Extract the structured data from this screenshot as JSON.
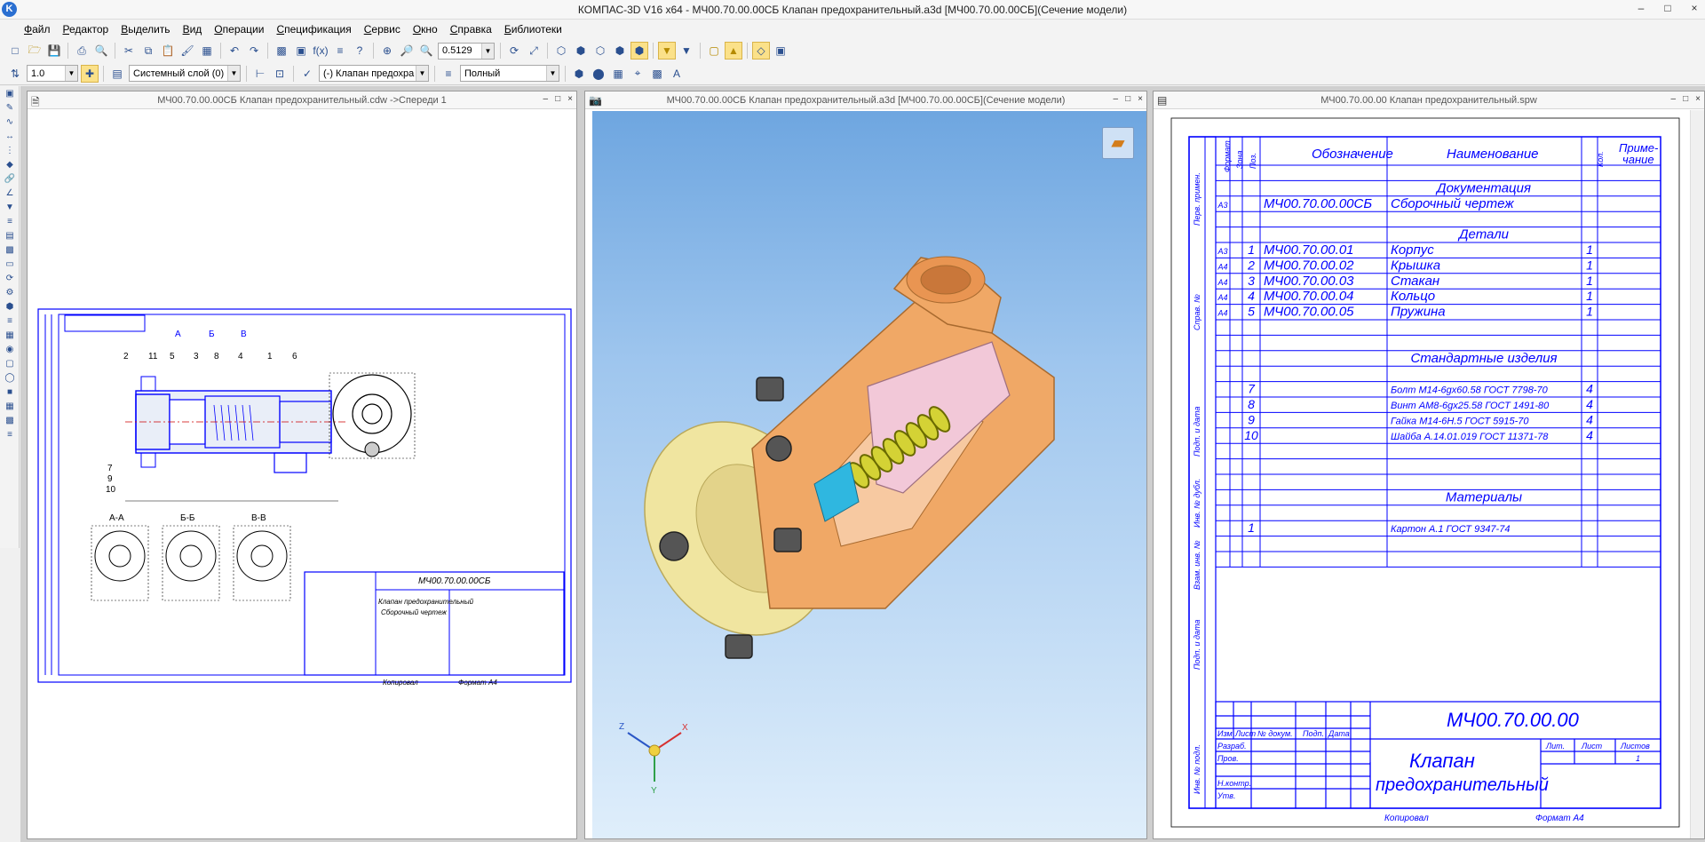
{
  "app": {
    "title": "КОМПАС-3D V16  x64 - МЧ00.70.00.00СБ Клапан предохранительный.a3d [МЧ00.70.00.00СБ](Сечение модели)",
    "window_buttons": [
      "–",
      "□",
      "×"
    ]
  },
  "menu": [
    "Файл",
    "Редактор",
    "Выделить",
    "Вид",
    "Операции",
    "Спецификация",
    "Сервис",
    "Окно",
    "Справка",
    "Библиотеки"
  ],
  "toolbar1": {
    "zoom_value": "0.5129"
  },
  "toolbar2": {
    "step_value": "1.0",
    "layer_value": "Системный слой (0)",
    "object_value": "(-) Клапан предохра",
    "view_mode_value": "Полный"
  },
  "windows": {
    "drawing": {
      "title": "МЧ00.70.00.00СБ Клапан предохранительный.cdw ->Спереди 1"
    },
    "model": {
      "title": "МЧ00.70.00.00СБ Клапан предохранительный.a3d [МЧ00.70.00.00СБ](Сечение модели)"
    },
    "spec": {
      "title": "МЧ00.70.00.00 Клапан  предохранительный.spw"
    },
    "buttons": [
      "–",
      "□",
      "×"
    ]
  },
  "axes": {
    "x": "X",
    "y": "Y",
    "z": "Z"
  },
  "drawing": {
    "callouts": [
      "2",
      "11",
      "5",
      "3",
      "8",
      "4",
      "1",
      "6",
      "7",
      "9",
      "10"
    ],
    "section_marks": [
      "А",
      "Б",
      "В"
    ],
    "section_views": [
      "А-А",
      "Б-Б",
      "В-В"
    ],
    "title_block": {
      "code": "МЧ00.70.00.00СБ",
      "name_line1": "Клапан предохранительный",
      "name_line2": "Сборочный чертеж",
      "copied": "Копировал",
      "format": "Формат   А4"
    }
  },
  "spec": {
    "headers": {
      "format": "Формат",
      "zone": "Зона",
      "pos": "Поз.",
      "designation": "Обозначение",
      "name": "Наименование",
      "qty": "Кол.",
      "note1": "Приме-",
      "note2": "чание"
    },
    "rows": [
      {
        "section": ""
      },
      {
        "section": "Документация"
      },
      {
        "format": "А3",
        "designation": "МЧ00.70.00.00СБ",
        "name": "Сборочный чертеж"
      },
      {
        "section": ""
      },
      {
        "section": "Детали"
      },
      {
        "format": "А3",
        "pos": "1",
        "designation": "МЧ00.70.00.01",
        "name": "Корпус",
        "qty": "1"
      },
      {
        "format": "А4",
        "pos": "2",
        "designation": "МЧ00.70.00.02",
        "name": "Крышка",
        "qty": "1"
      },
      {
        "format": "А4",
        "pos": "3",
        "designation": "МЧ00.70.00.03",
        "name": "Стакан",
        "qty": "1"
      },
      {
        "format": "А4",
        "pos": "4",
        "designation": "МЧ00.70.00.04",
        "name": "Кольцо",
        "qty": "1"
      },
      {
        "format": "А4",
        "pos": "5",
        "designation": "МЧ00.70.00.05",
        "name": "Пружина",
        "qty": "1"
      },
      {
        "section": ""
      },
      {
        "section": ""
      },
      {
        "section": "Стандартные изделия"
      },
      {
        "section": ""
      },
      {
        "pos": "7",
        "name": "Болт М14-6gх60.58 ГОСТ 7798-70",
        "qty": "4"
      },
      {
        "pos": "8",
        "name": "Винт АМ8-6gх25.58 ГОСТ 1491-80",
        "qty": "4"
      },
      {
        "pos": "9",
        "name": "Гайка М14-6Н.5 ГОСТ 5915-70",
        "qty": "4"
      },
      {
        "pos": "10",
        "name": "Шайба А.14.01.019 ГОСТ 11371-78",
        "qty": "4"
      },
      {
        "section": ""
      },
      {
        "section": ""
      },
      {
        "section": ""
      },
      {
        "section": "Материалы"
      },
      {
        "section": ""
      },
      {
        "pos": "1",
        "name": "Картон А.1 ГОСТ 9347-74",
        "qty": ""
      },
      {
        "section": ""
      },
      {
        "section": ""
      }
    ],
    "side_labels": [
      "Перв. примен.",
      "Справ. №",
      "Подп. и дата",
      "Инв. № дубл.",
      "Взам. инв. №",
      "Подп. и дата",
      "Инв. № подл."
    ],
    "title_block": {
      "code": "МЧ00.70.00.00",
      "name_line1": "Клапан",
      "name_line2": "предохранительный",
      "change_headers": [
        "Изм",
        "Лист",
        "№ докум.",
        "Подп.",
        "Дата"
      ],
      "roles": [
        "Разраб.",
        "Пров.",
        "",
        "Н.контр.",
        "Утв."
      ],
      "lit": "Лит.",
      "sheet": "Лист",
      "sheets": "Листов",
      "sheets_value": "1",
      "copied": "Копировал",
      "format": "Формат      А4"
    }
  }
}
